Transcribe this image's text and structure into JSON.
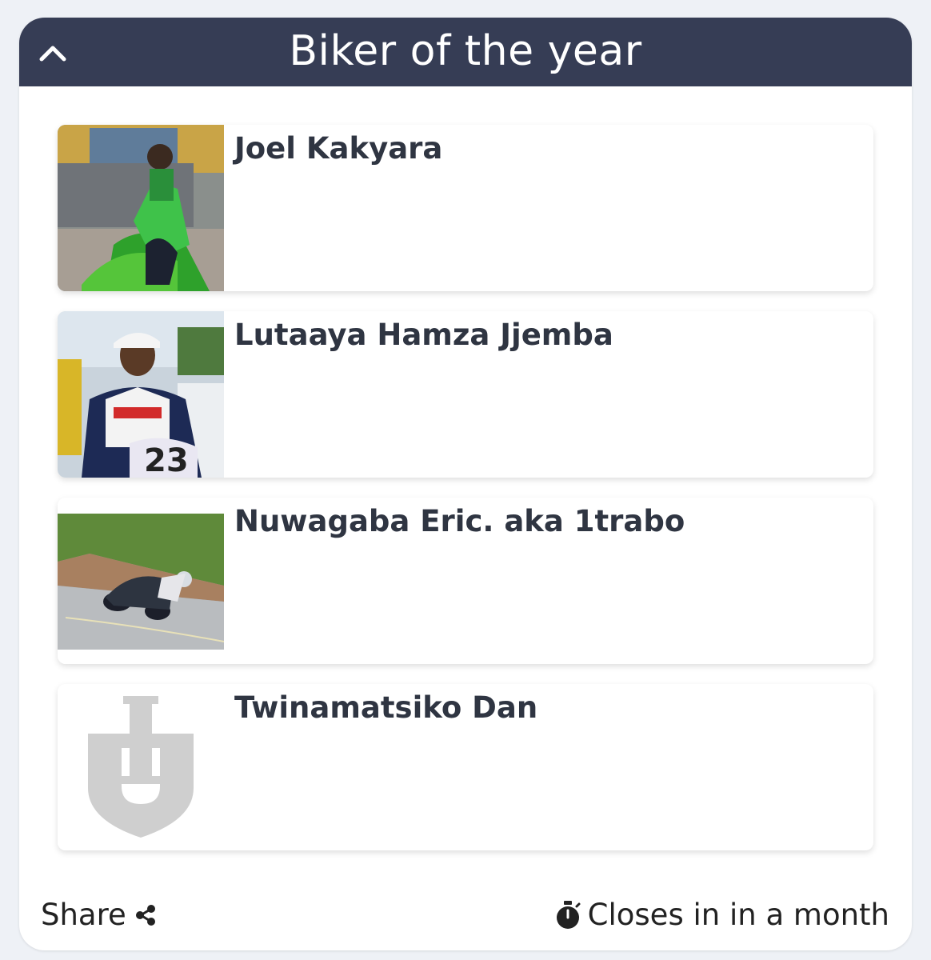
{
  "poll": {
    "title": "Biker of the year",
    "collapse_icon": "chevron-up-icon"
  },
  "candidates": [
    {
      "name": "Joel Kakyara"
    },
    {
      "name": "Lutaaya Hamza Jjemba"
    },
    {
      "name": "Nuwagaba Eric. aka 1trabo"
    },
    {
      "name": "Twinamatsiko Dan"
    }
  ],
  "footer": {
    "share_label": "Share",
    "share_icon": "share-icon",
    "closes_label": "Closes in in a month",
    "timer_icon": "stopwatch-icon"
  },
  "colors": {
    "header_bg": "#363d55",
    "page_bg": "#eef1f6",
    "text": "#2f3542"
  }
}
